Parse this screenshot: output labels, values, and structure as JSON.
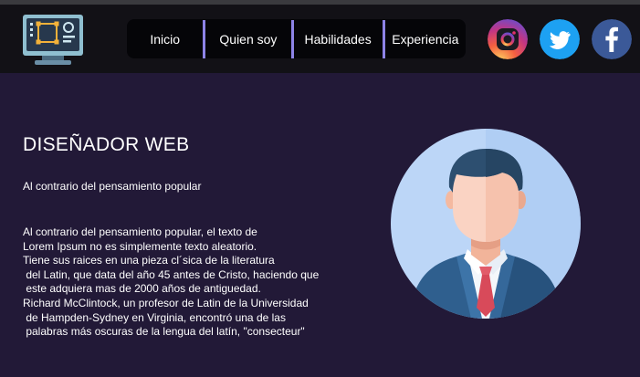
{
  "nav": {
    "items": [
      {
        "label": "Inicio"
      },
      {
        "label": "Quien soy"
      },
      {
        "label": "Habilidades"
      },
      {
        "label": "Experiencia"
      }
    ]
  },
  "social": [
    {
      "icon": "instagram-icon"
    },
    {
      "icon": "twitter-icon"
    },
    {
      "icon": "facebook-icon"
    }
  ],
  "hero": {
    "title": "DISEÑADOR WEB",
    "subtitle": "Al contrario del pensamiento popular",
    "paragraph_lines": [
      "Al contrario del pensamiento popular, el texto de",
      "Lorem Ipsum no es simplemente texto aleatorio.",
      "Tiene sus raices en una pieza cl´sica de la literatura",
      " del Latin, que data del año 45 antes de Cristo, haciendo que",
      " este adquiera mas de 2000 años de antiguedad.",
      "Richard McClintock, un profesor de Latin de la Universidad",
      " de Hampden-Sydney en Virginia, encontró una de las",
      " palabras más oscuras de la lengua del latín, \"consecteur\""
    ]
  },
  "colors": {
    "background": "#221937",
    "header": "#121116",
    "nav_separator": "#8d83e6",
    "twitter": "#1da1f2",
    "facebook": "#3b5998"
  }
}
